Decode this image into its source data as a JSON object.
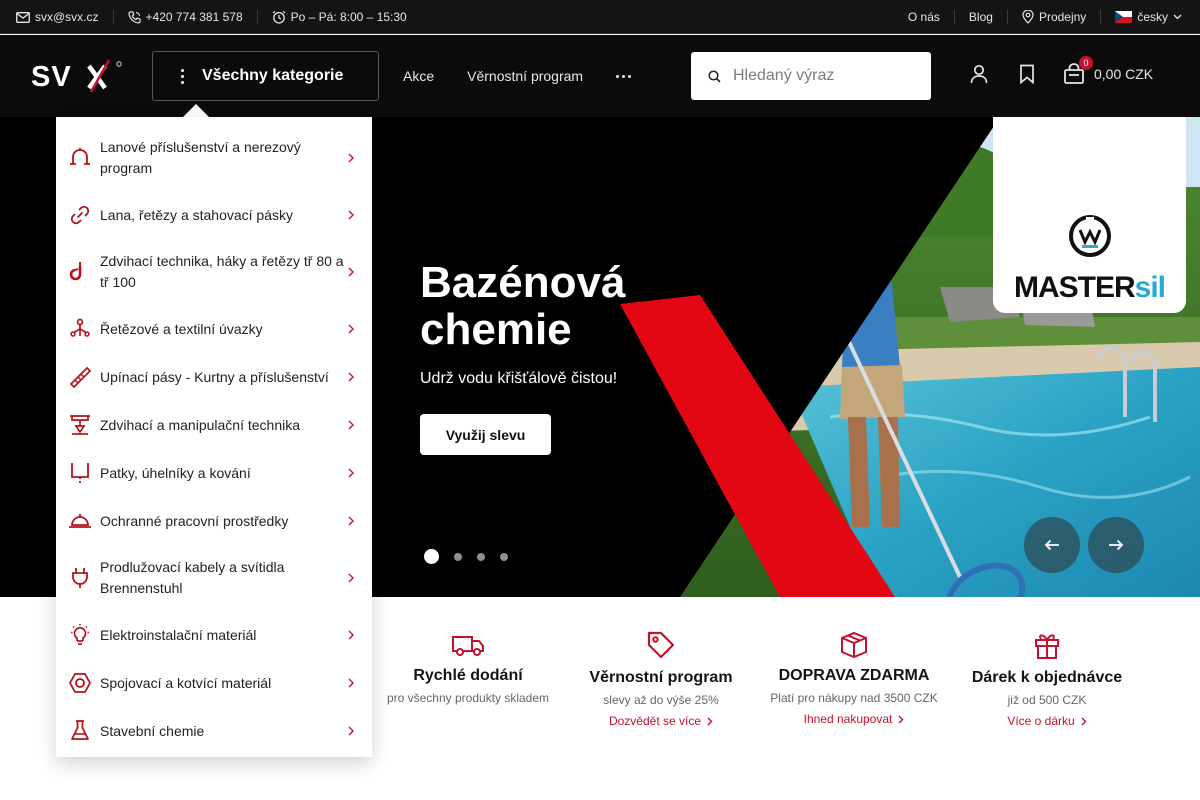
{
  "topbar": {
    "email": "svx@svx.cz",
    "phone": "+420 774 381 578",
    "hours": "Po – Pá: 8:00 – 15:30",
    "about": "O nás",
    "blog": "Blog",
    "stores": "Prodejny",
    "language": "česky"
  },
  "header": {
    "logo_text": "SVX",
    "categories_button": "Všechny kategorie",
    "nav": [
      "Akce",
      "Věrnostní program"
    ],
    "search_placeholder": "Hledaný výraz",
    "cart_count": "0",
    "cart_total": "0,00 CZK"
  },
  "menu": {
    "items": [
      {
        "label": "Lanové příslušenství a nerezový program",
        "icon": "rope-accessory-icon"
      },
      {
        "label": "Lana, řetězy a stahovací pásky",
        "icon": "chain-link-icon"
      },
      {
        "label": "Zdvihací technika, háky a řetězy tř 80 a tř 100",
        "icon": "hook-icon"
      },
      {
        "label": "Řetězové a textilní úvazky",
        "icon": "sling-icon"
      },
      {
        "label": "Upínací pásy - Kurtny a příslušenství",
        "icon": "strap-icon"
      },
      {
        "label": "Zdvihací a manipulační technika",
        "icon": "hoist-icon"
      },
      {
        "label": "Patky, úhelníky a kování",
        "icon": "bracket-icon"
      },
      {
        "label": "Ochranné pracovní prostředky",
        "icon": "helmet-icon"
      },
      {
        "label": "Prodlužovací kabely a svítidla Brennenstuhl",
        "icon": "plug-icon"
      },
      {
        "label": "Elektroinstalační materiál",
        "icon": "bulb-icon"
      },
      {
        "label": "Spojovací a kotvící materiál",
        "icon": "hex-nut-icon"
      },
      {
        "label": "Stavební chemie",
        "icon": "flask-icon"
      }
    ]
  },
  "hero": {
    "title": "Bazénová chemie",
    "subtitle": "Udrž vodu křišťálově čistou!",
    "cta": "Využij slevu",
    "brand": "MASTER",
    "brand_suffix": "sil",
    "slides": 4,
    "active_slide": 1
  },
  "usps": [
    {
      "title": "Rychlé dodání",
      "desc": "pro všechny produkty skladem",
      "link": "",
      "icon": "truck-icon"
    },
    {
      "title": "Věrnostní program",
      "desc": "slevy až do výše 25%",
      "link": "Dozvědět se více",
      "icon": "tag-icon"
    },
    {
      "title": "DOPRAVA ZDARMA",
      "desc": "Platí pro nákupy nad 3500 CZK",
      "link": "Ihned nakupovat",
      "icon": "box-icon"
    },
    {
      "title": "Dárek k objednávce",
      "desc": "již od 500 CZK",
      "link": "Více o dárku",
      "icon": "gift-icon"
    }
  ],
  "colors": {
    "accent": "#c8102e",
    "header_bg": "#0b0b0b",
    "topbar_bg": "#141414"
  }
}
